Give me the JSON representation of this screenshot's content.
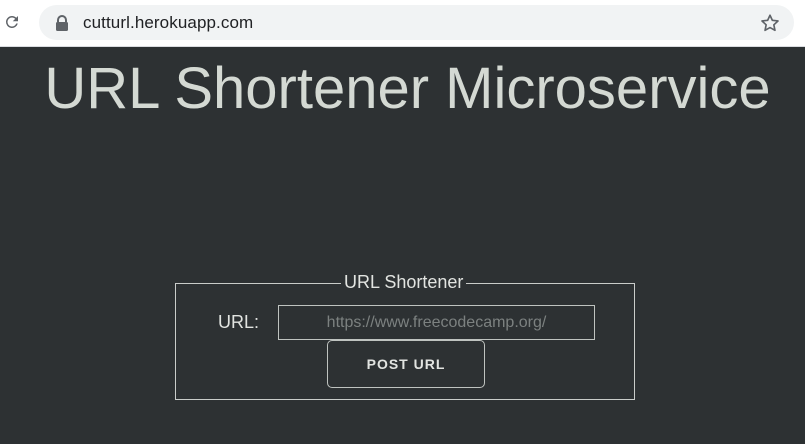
{
  "browser": {
    "address": "cutturl.herokuapp.com",
    "icons": {
      "reload": "reload-icon",
      "lock": "lock-icon",
      "bookmark": "star-icon"
    }
  },
  "page": {
    "title": "URL Shortener Microservice",
    "form": {
      "legend": "URL Shortener",
      "url_label": "URL:",
      "url_placeholder": "https://www.freecodecamp.org/",
      "url_value": "",
      "submit_label": "POST URL"
    },
    "colors": {
      "background": "#2d3133",
      "text": "#d4d9d3",
      "border": "#c9ccca"
    }
  }
}
